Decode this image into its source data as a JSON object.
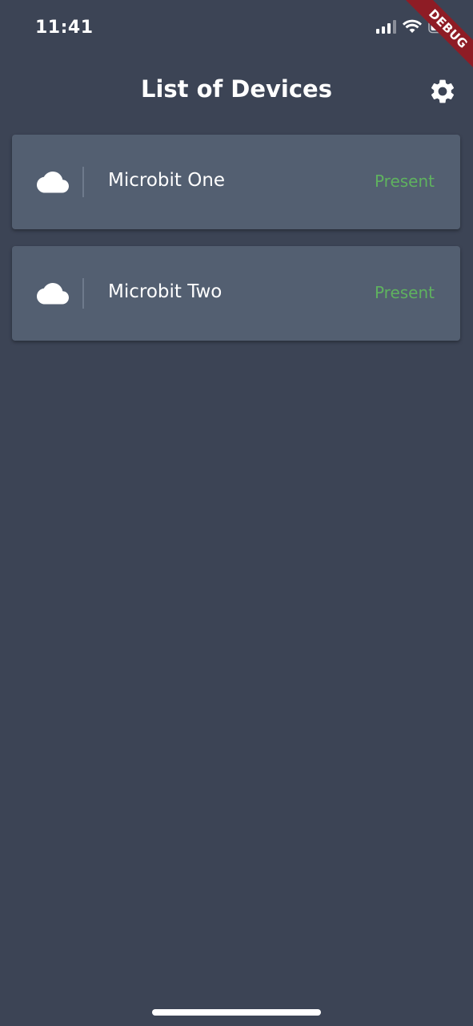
{
  "status_bar": {
    "time": "11:41",
    "debug_label": "DEBUG"
  },
  "header": {
    "title": "List of Devices",
    "settings_icon": "gear-icon"
  },
  "devices": [
    {
      "icon": "cloud-icon",
      "name": "Microbit One",
      "status": "Present"
    },
    {
      "icon": "cloud-icon",
      "name": "Microbit Two",
      "status": "Present"
    }
  ],
  "colors": {
    "background": "#3c4455",
    "card": "#535f71",
    "status_present": "#5fb25f",
    "debug_banner": "#8e1c25"
  }
}
